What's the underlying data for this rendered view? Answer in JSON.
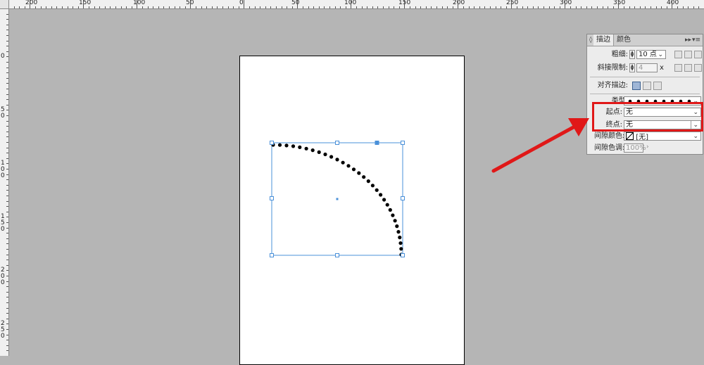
{
  "ruler": {
    "top_labels": [
      "200",
      "150",
      "100",
      "50",
      "0",
      "50",
      "100",
      "150",
      "200",
      "250",
      "300",
      "350",
      "400"
    ],
    "left_labels": [
      "0",
      "50",
      "100",
      "150",
      "200",
      "250"
    ]
  },
  "panel": {
    "tabs": [
      {
        "label": "描边",
        "active": true
      },
      {
        "label": "颜色",
        "active": false
      }
    ],
    "weight_label": "粗细:",
    "weight_value": "10 点",
    "miter_label": "斜接限制:",
    "miter_value": "4",
    "miter_unit": "x",
    "align_label": "对齐描边:",
    "type_label": "类型:",
    "start_label": "起点:",
    "start_value": "无",
    "end_label": "终点:",
    "end_value": "无",
    "gap_color_label": "间隙颜色:",
    "gap_color_value": "[无]",
    "gap_tint_label": "间隙色调:",
    "gap_tint_value": "100%"
  },
  "colors": {
    "highlight": "#e01818",
    "selection": "#4a90d9",
    "canvas": "#b5b5b5"
  }
}
